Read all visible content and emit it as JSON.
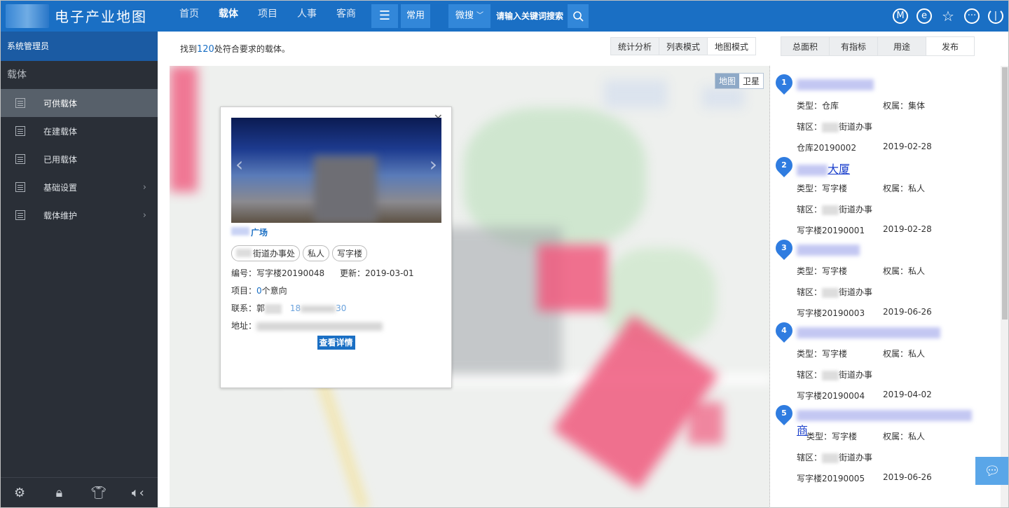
{
  "app": {
    "title": "电子产业地图"
  },
  "nav": [
    {
      "label": "首页",
      "active": false
    },
    {
      "label": "载体",
      "active": true
    },
    {
      "label": "项目",
      "active": false
    },
    {
      "label": "人事",
      "active": false
    },
    {
      "label": "客商",
      "active": false
    }
  ],
  "toolbar": {
    "menu_icon": "menu-icon",
    "common_label": "常用"
  },
  "search": {
    "type_label": "微搜",
    "placeholder": "请输入关键词搜索"
  },
  "top_icons": [
    "m-icon",
    "e-icon",
    "star-icon",
    "more-icon",
    "power-icon"
  ],
  "sidebar": {
    "admin": "系统管理员",
    "section": "载体",
    "items": [
      {
        "label": "可供载体",
        "active": true,
        "expandable": false
      },
      {
        "label": "在建载体",
        "active": false,
        "expandable": false
      },
      {
        "label": "已用载体",
        "active": false,
        "expandable": false
      },
      {
        "label": "基础设置",
        "active": false,
        "expandable": true
      },
      {
        "label": "载体维护",
        "active": false,
        "expandable": true
      }
    ]
  },
  "result": {
    "prefix": "找到",
    "count": "120",
    "suffix": "处符合要求的载体。"
  },
  "mode_tabs": [
    {
      "label": "统计分析",
      "active": false
    },
    {
      "label": "列表模式",
      "active": false
    },
    {
      "label": "地图模式",
      "active": true
    }
  ],
  "filter_tabs": [
    {
      "label": "总面积",
      "active": false
    },
    {
      "label": "有指标",
      "active": false
    },
    {
      "label": "用途",
      "active": false
    },
    {
      "label": "发布",
      "active": true
    }
  ],
  "map": {
    "type_map": "地图",
    "type_satellite": "卫星",
    "popup": {
      "title": "广场",
      "chips": [
        "街道办事处",
        "私人",
        "写字楼"
      ],
      "code_label": "编号：",
      "code": "写字楼20190048",
      "update_label": "更新：",
      "update": "2019-03-01",
      "project_label": "项目：",
      "project_count": "0",
      "project_suffix": "个意向",
      "contact_label": "联系：",
      "contact_name": "郭",
      "contact_phone_pre": "18",
      "contact_phone_post": "30",
      "address_label": "地址：",
      "detail_button": "查看详情"
    }
  },
  "list": [
    {
      "index": "1",
      "title_suffix": "",
      "type": "类型：仓库",
      "ownership": "权属：集体",
      "district": "辖区：",
      "district_suffix": "街道办事",
      "code": "仓库20190002",
      "date": "2019-02-28"
    },
    {
      "index": "2",
      "title_suffix": "大厦",
      "type": "类型：写字楼",
      "ownership": "权属：私人",
      "district": "辖区：",
      "district_suffix": "街道办事",
      "code": "写字楼20190001",
      "date": "2019-02-28"
    },
    {
      "index": "3",
      "title_suffix": "",
      "type": "类型：写字楼",
      "ownership": "权属：私人",
      "district": "辖区：",
      "district_suffix": "街道办事",
      "code": "写字楼20190003",
      "date": "2019-06-26"
    },
    {
      "index": "4",
      "title_suffix": "",
      "type": "类型：写字楼",
      "ownership": "权属：私人",
      "district": "辖区：",
      "district_suffix": "街道办事",
      "code": "写字楼20190004",
      "date": "2019-04-02"
    },
    {
      "index": "5",
      "title_suffix": "商",
      "type": "类型：写字楼",
      "ownership": "权属：私人",
      "district": "辖区：",
      "district_suffix": "街道办事",
      "code": "写字楼20190005",
      "date": "2019-06-26"
    }
  ],
  "colors": {
    "primary": "#1a6fc4",
    "sidebar": "#2a2f37",
    "admin_bar": "#1b5ba3",
    "pin": "#2f7ce0",
    "highlight": "#f05a7e"
  }
}
